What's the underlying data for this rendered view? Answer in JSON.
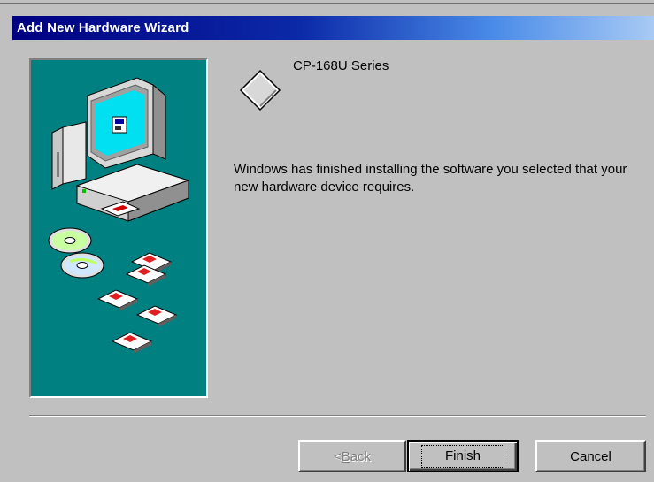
{
  "window": {
    "title": "Add New Hardware Wizard"
  },
  "device": {
    "name": "CP-168U Series",
    "icon": "generic-device-diamond-icon"
  },
  "message": "Windows has finished installing the software you selected that your new hardware device requires.",
  "buttons": {
    "back_prefix": "< ",
    "back_mnemonic": "B",
    "back_rest": "ack",
    "finish": "Finish",
    "cancel": "Cancel"
  },
  "colors": {
    "title_start": "#000080",
    "title_end": "#a8caf4",
    "illustration_bg": "#008080",
    "dialog_face": "#c0c0c0"
  }
}
